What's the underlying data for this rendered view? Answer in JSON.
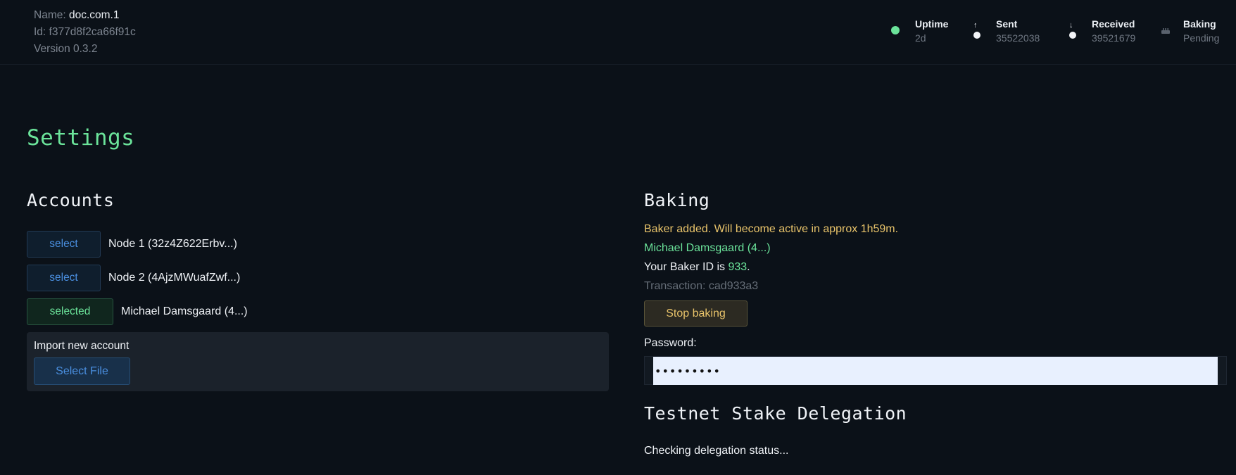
{
  "node": {
    "name_label": "Name: ",
    "name_value": "doc.com.1",
    "id_text": "Id: f377d8f2ca66f91c",
    "version_text": "Version 0.3.2"
  },
  "stats": {
    "uptime_label": "Uptime",
    "uptime_value": "2d",
    "sent_label": "Sent",
    "sent_value": "35522038",
    "received_label": "Received",
    "received_value": "39521679",
    "baking_label": "Baking",
    "baking_value": "Pending"
  },
  "page_title": "Settings",
  "accounts": {
    "heading": "Accounts",
    "items": [
      {
        "button": "select",
        "name": "Node 1 (32z4Z622Erbv...)"
      },
      {
        "button": "select",
        "name": "Node 2 (4AjzMWuafZwf...)"
      },
      {
        "button": "selected",
        "name": "Michael Damsgaard (4...)"
      }
    ],
    "import_label": "Import new account",
    "select_file_label": "Select File"
  },
  "baking": {
    "heading": "Baking",
    "status_message": "Baker added. Will become active in approx 1h59m.",
    "account_name": "Michael Damsgaard (4...)",
    "baker_id_prefix": "Your Baker ID is ",
    "baker_id": "933",
    "baker_id_suffix": ".",
    "transaction_text": "Transaction: cad933a3",
    "stop_button": "Stop baking",
    "password_label": "Password:",
    "password_value": "•••••••••"
  },
  "delegation": {
    "heading": "Testnet Stake Delegation",
    "status": "Checking delegation status..."
  },
  "colors": {
    "background": "#0b1118",
    "accent_green": "#6be39a",
    "accent_blue": "#4a8fe0",
    "accent_yellow": "#e8c36a"
  }
}
